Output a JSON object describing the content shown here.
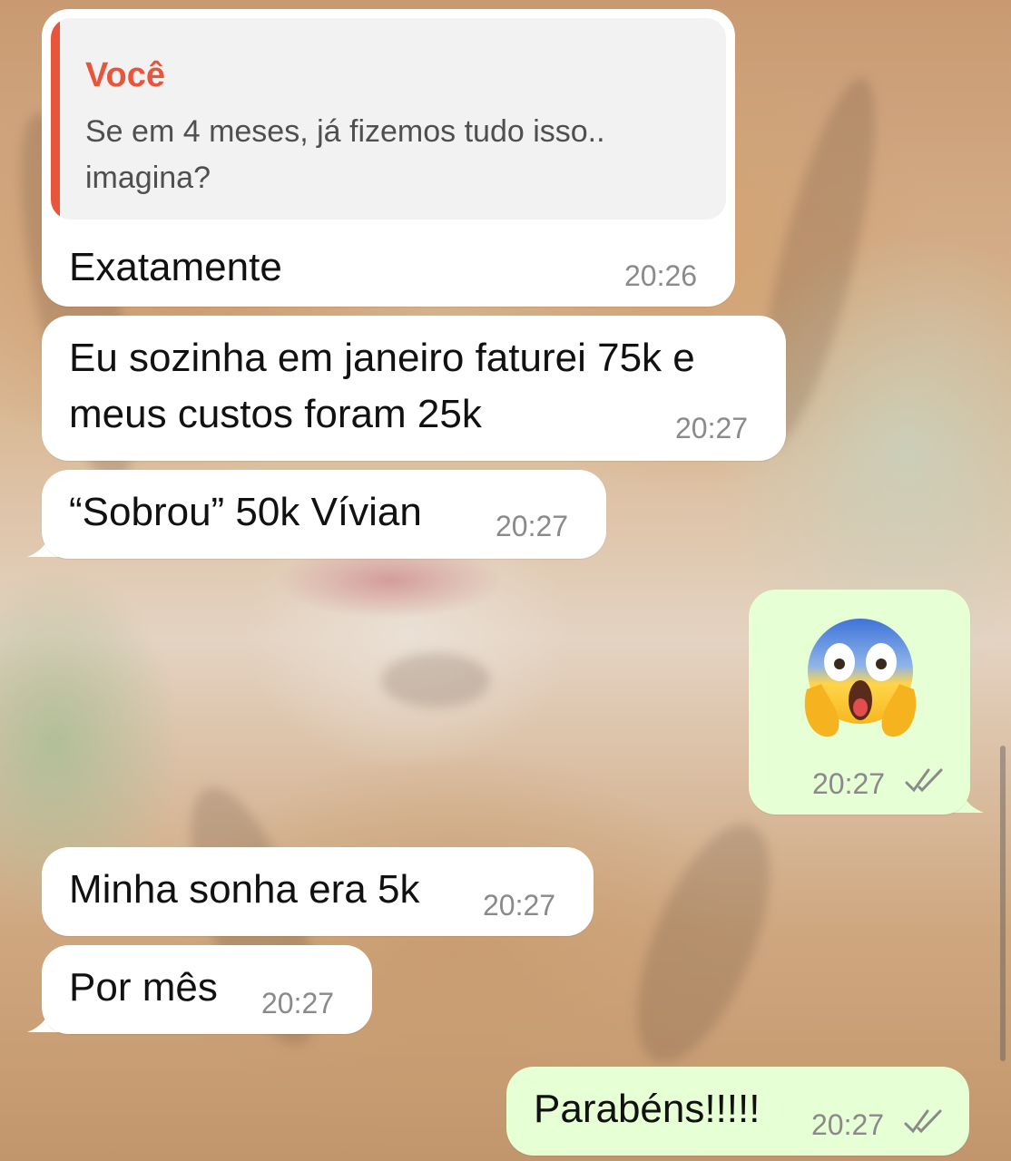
{
  "chat": {
    "messages": [
      {
        "direction": "incoming",
        "quote": {
          "author": "Você",
          "text": "Se em 4 meses, já fizemos tudo isso..\nimagina?"
        },
        "text": "Exatamente",
        "time": "20:26"
      },
      {
        "direction": "incoming",
        "text": "Eu sozinha em janeiro faturei 75k e\nmeus custos foram 25k",
        "time": "20:27"
      },
      {
        "direction": "incoming",
        "text": "“Sobrou” 50k Vívian",
        "time": "20:27"
      },
      {
        "direction": "outgoing",
        "emoji": "face-screaming-in-fear",
        "time": "20:27",
        "status": "read"
      },
      {
        "direction": "incoming",
        "text": "Minha sonha era 5k",
        "time": "20:27"
      },
      {
        "direction": "incoming",
        "text": "Por mês",
        "time": "20:27"
      },
      {
        "direction": "outgoing",
        "text": "Parabéns!!!!!",
        "time": "20:27",
        "status": "read"
      }
    ]
  },
  "colors": {
    "incoming_bubble": "#ffffff",
    "outgoing_bubble": "#e6ffd4",
    "quote_accent": "#e8553a",
    "timestamp": "#8a8a8a"
  }
}
